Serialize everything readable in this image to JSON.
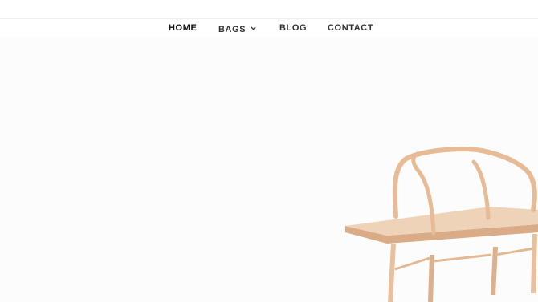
{
  "nav": {
    "items": [
      {
        "label": "HOME",
        "active": true
      },
      {
        "label": "BAGS",
        "has_dropdown": true
      },
      {
        "label": "BLOG"
      },
      {
        "label": "CONTACT"
      }
    ]
  },
  "hero": {
    "image": "wooden-chair",
    "background_color": "#fcfcfc",
    "wood_color": "#e8c09d"
  }
}
